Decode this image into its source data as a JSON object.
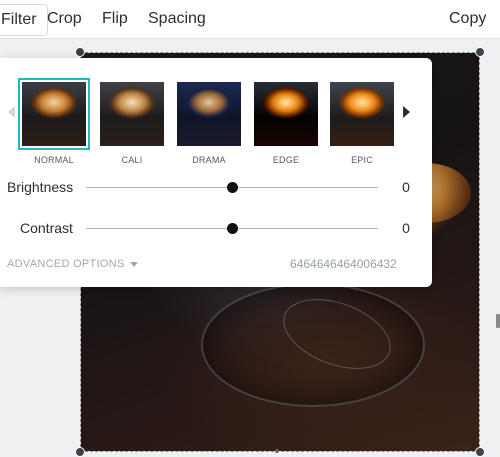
{
  "toolbar": {
    "filter_label": "Filter",
    "crop_label": "Crop",
    "flip_label": "Flip",
    "spacing_label": "Spacing",
    "copy_label": "Copy"
  },
  "filters": [
    {
      "label": "NORMAL",
      "selected": true
    },
    {
      "label": "CALI",
      "selected": false
    },
    {
      "label": "DRAMA",
      "selected": false
    },
    {
      "label": "EDGE",
      "selected": false
    },
    {
      "label": "EPIC",
      "selected": false
    }
  ],
  "adjustments": {
    "brightness": {
      "label": "Brightness",
      "value": "0",
      "level": 0.5
    },
    "contrast": {
      "label": "Contrast",
      "value": "0",
      "level": 0.5
    }
  },
  "advanced_options_label": "ADVANCED OPTIONS",
  "filter_code": "6464646464006432",
  "colors": {
    "accent_selection": "#1fb8c4",
    "toolbar_text": "#2b2f33",
    "muted_text": "#a3a8ae"
  },
  "icons": {
    "prev": "chevron-left-icon",
    "next": "chevron-right-icon",
    "dropdown": "caret-down-icon"
  }
}
